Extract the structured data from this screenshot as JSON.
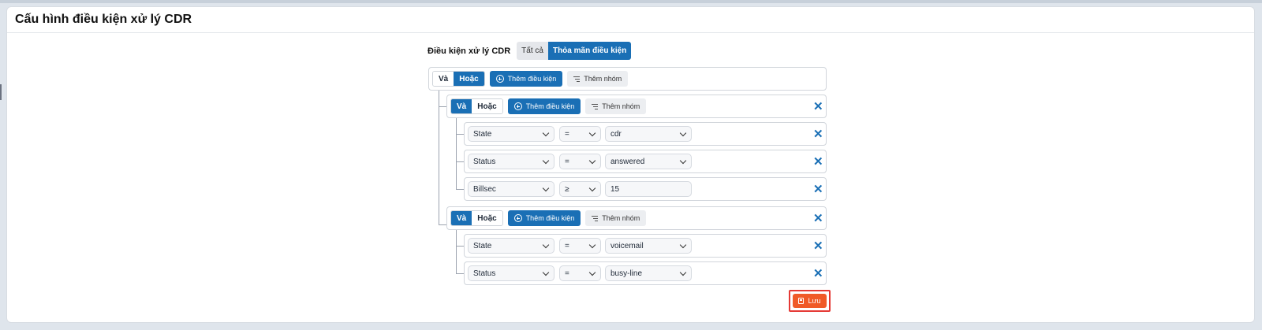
{
  "page": {
    "title": "Cấu hình điều kiện xử lý CDR"
  },
  "condition": {
    "label": "Điều kiện xử lý CDR",
    "options": [
      "Tất cả",
      "Thỏa mãn điều kiện"
    ],
    "selected": "Thỏa mãn điều kiện"
  },
  "root": {
    "and_label": "Và",
    "or_label": "Hoặc",
    "selected": "Hoặc",
    "add_condition_label": "Thêm điều kiện",
    "add_group_label": "Thêm nhóm"
  },
  "groups": [
    {
      "and_label": "Và",
      "or_label": "Hoặc",
      "selected": "Và",
      "add_condition_label": "Thêm điều kiện",
      "add_group_label": "Thêm nhóm",
      "conditions": [
        {
          "field": "State",
          "operator": "=",
          "value": "cdr"
        },
        {
          "field": "Status",
          "operator": "=",
          "value": "answered"
        },
        {
          "field": "Billsec",
          "operator": "≥",
          "value": "15"
        }
      ]
    },
    {
      "and_label": "Và",
      "or_label": "Hoặc",
      "selected": "Và",
      "add_condition_label": "Thêm điều kiện",
      "add_group_label": "Thêm nhóm",
      "conditions": [
        {
          "field": "State",
          "operator": "=",
          "value": "voicemail"
        },
        {
          "field": "Status",
          "operator": "=",
          "value": "busy-line"
        }
      ]
    }
  ],
  "close_glyph": "✕",
  "save_label": "Lưu",
  "colors": {
    "primary": "#1a6fb5",
    "save": "#f05a28",
    "highlight": "#e53935"
  }
}
